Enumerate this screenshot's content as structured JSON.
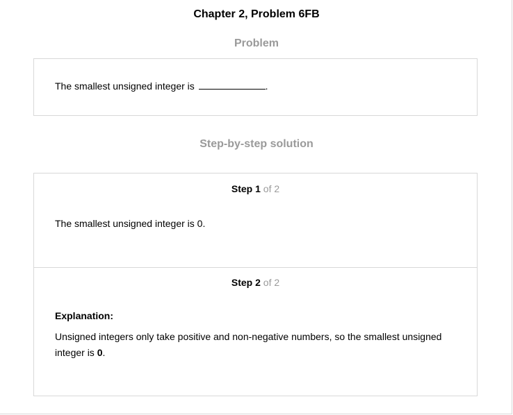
{
  "page": {
    "title": "Chapter 2, Problem 6FB"
  },
  "problem": {
    "heading": "Problem",
    "text_before_blank": "The smallest unsigned integer is",
    "text_after_blank": "."
  },
  "solution": {
    "heading": "Step-by-step solution",
    "steps": [
      {
        "word": "Step",
        "number": "1",
        "of_text": "of 2",
        "text": "The smallest unsigned integer is 0."
      },
      {
        "word": "Step",
        "number": "2",
        "of_text": "of 2",
        "explanation_label": "Explanation:",
        "explanation_text_line1": "Unsigned integers only take positive and non-negative numbers, so the smallest unsigned",
        "explanation_text_line2_prefix": "integer is",
        "explanation_answer": "0",
        "explanation_text_suffix": "."
      }
    ]
  }
}
